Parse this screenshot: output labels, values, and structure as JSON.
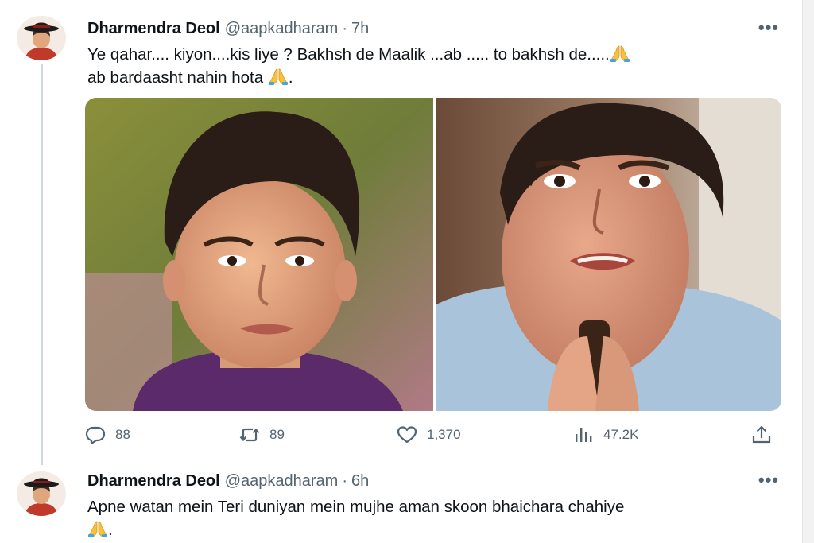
{
  "tweets": [
    {
      "author_name": "Dharmendra Deol",
      "handle": "@aapkadharam",
      "separator": "·",
      "time": "7h",
      "more": "•••",
      "text_line1": "Ye qahar.... kiyon....kis liye ? Bakhsh de Maalik ...ab ..... to bakhsh de.....",
      "text_line2": "ab bardaasht nahin hota",
      "text_line2_end": ".",
      "stats": {
        "replies": "88",
        "reposts": "89",
        "likes": "1,370",
        "views": "47.2K"
      }
    },
    {
      "author_name": "Dharmendra Deol",
      "handle": "@aapkadharam",
      "separator": "·",
      "time": "6h",
      "more": "•••",
      "text_line1": "Apne watan mein Teri duniyan mein mujhe aman skoon bhaichara chahiye",
      "text_line2_end": "."
    }
  ],
  "icons": {
    "reply": "speech-bubble-icon",
    "repost": "repost-arrows-icon",
    "like": "heart-icon",
    "views": "bar-chart-icon",
    "share": "upload-arrow-icon",
    "pray": "folded-hands-emoji"
  },
  "colors": {
    "text": "#0f1419",
    "secondary": "#536471",
    "thread_line": "#cfd9de"
  }
}
